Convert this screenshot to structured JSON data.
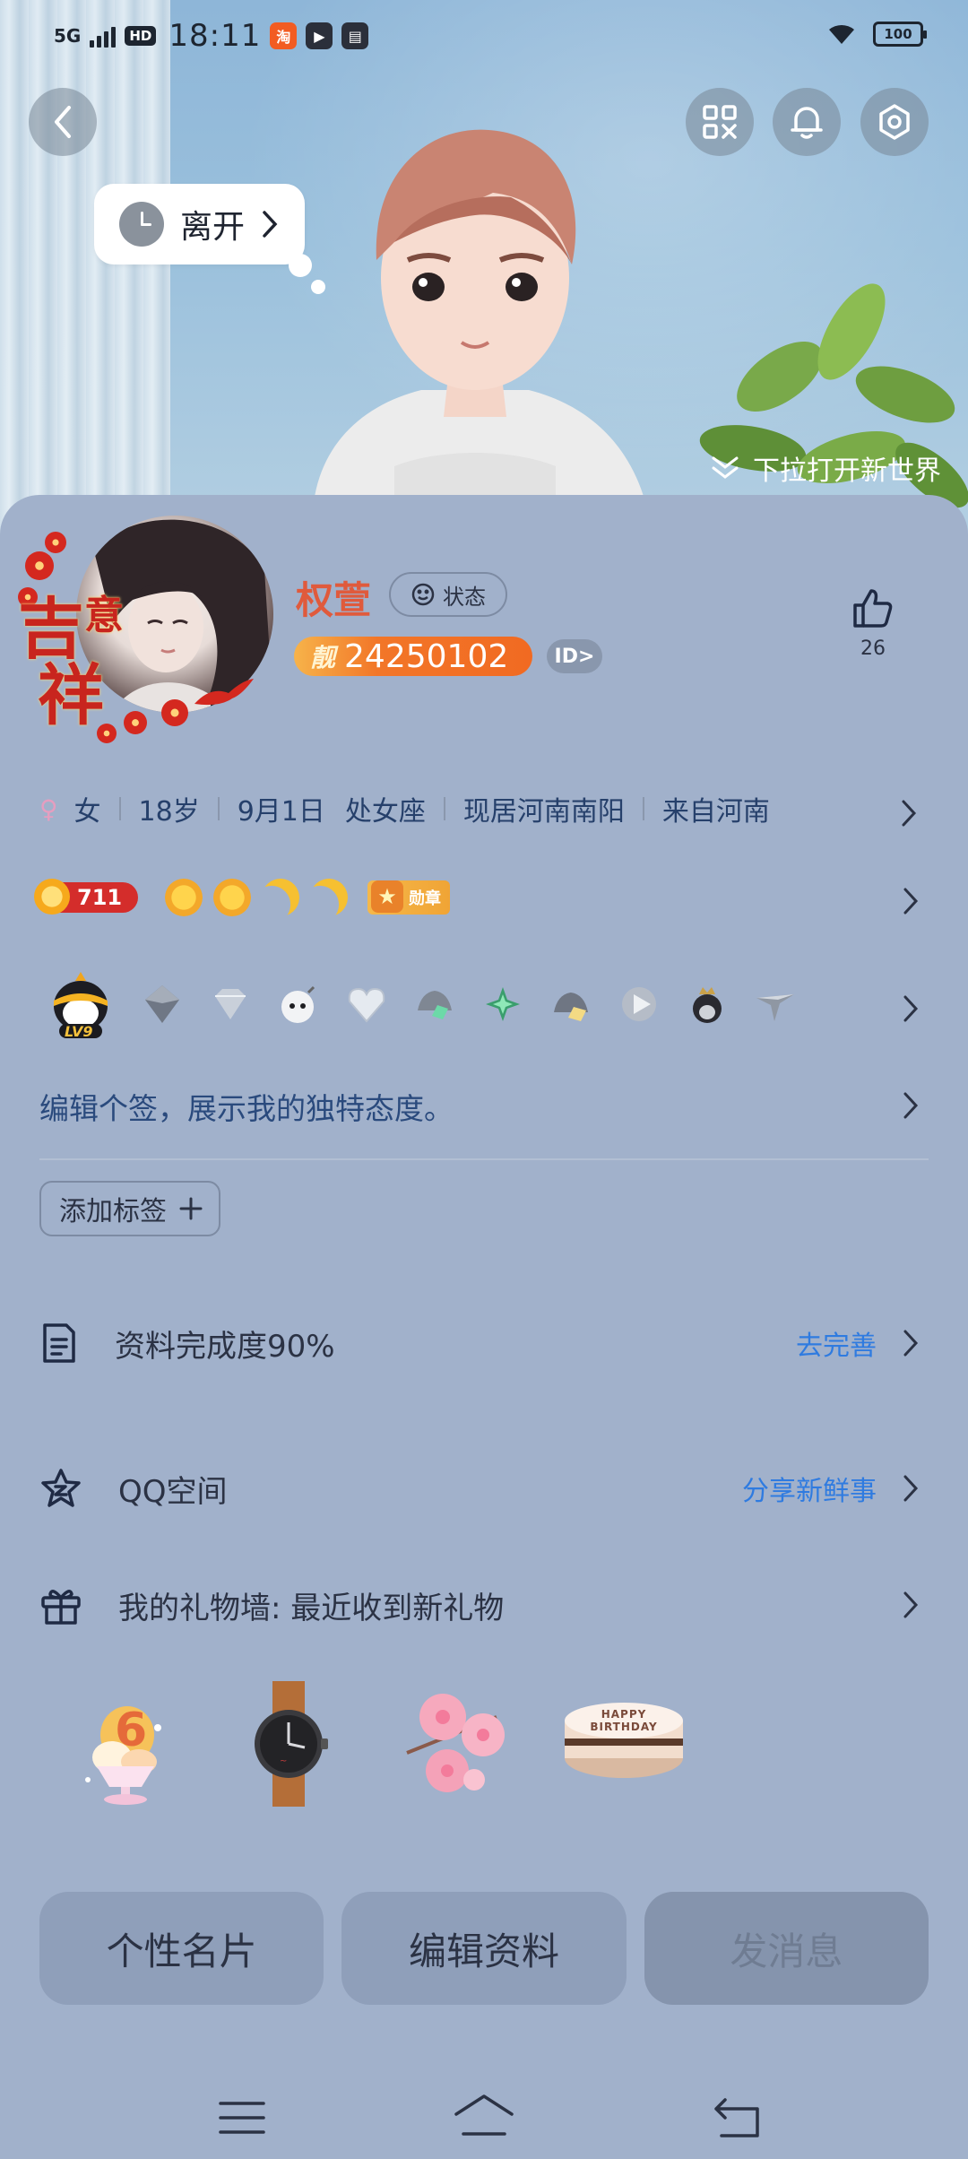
{
  "status_bar": {
    "network": "5G",
    "hd": "HD",
    "time": "18:11",
    "battery": "100"
  },
  "hero": {
    "away_status": "离开",
    "pull_hint": "下拉打开新世界"
  },
  "profile": {
    "nickname": "权萱",
    "status_label": "状态",
    "pretty_label": "靓",
    "qq_number": "24250102",
    "id_label": "ID>",
    "like_count": "26",
    "avatar_frame_text_1": "吉",
    "avatar_frame_text_2": "意",
    "avatar_frame_text_3": "祥"
  },
  "info": {
    "gender": "女",
    "age": "18岁",
    "birthday": "9月1日",
    "zodiac": "处女座",
    "location": "现居河南南阳",
    "hometown": "来自河南"
  },
  "medals": {
    "level": "711",
    "medal_label": "勋章",
    "penguin_level": "LV9"
  },
  "signature_placeholder": "编辑个签，展示我的独特态度。",
  "add_tag_label": "添加标签",
  "rows": {
    "completion_label": "资料完成度90%",
    "completion_action": "去完善",
    "qzone_label": "QQ空间",
    "qzone_action": "分享新鲜事",
    "gift_wall_label": "我的礼物墙: 最近收到新礼物",
    "cake_text": "HAPPY BIRTHDAY"
  },
  "buttons": {
    "card": "个性名片",
    "edit": "编辑资料",
    "message": "发消息"
  },
  "colors": {
    "background": "#a1b1cb",
    "link": "#2f7be0",
    "nickname": "#e05a3c"
  }
}
